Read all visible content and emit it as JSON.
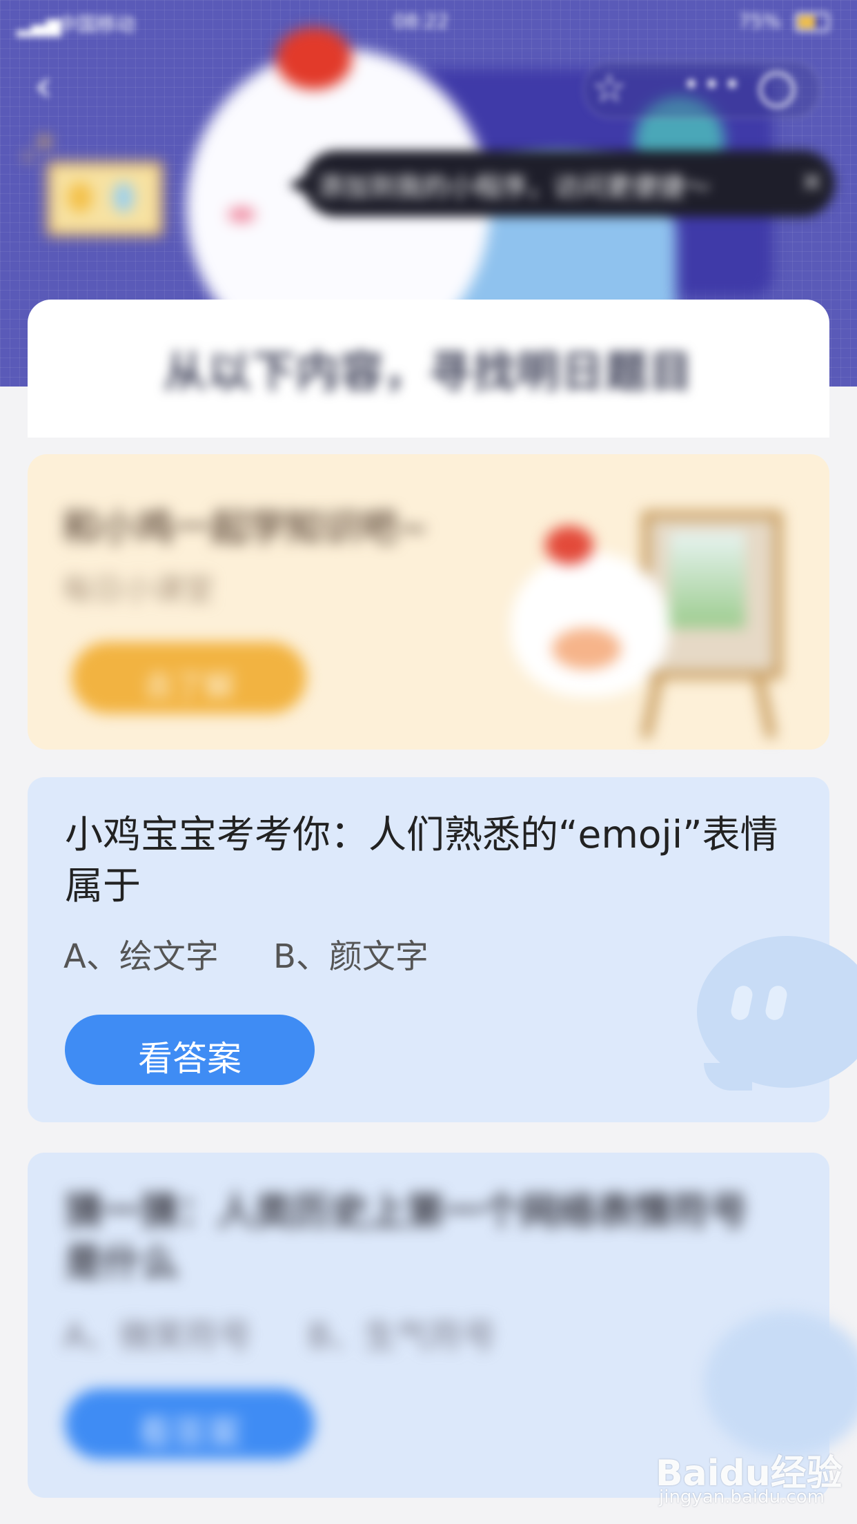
{
  "status_bar": {
    "carrier": "中国移动",
    "time": "08:22",
    "battery": "75%"
  },
  "header": {
    "tip": "添加到我的小程序，访问更便捷～",
    "title": "从以下内容，寻找明日题目"
  },
  "promo": {
    "title": "和小鸡一起学知识吧~",
    "subtitle": "每日小课堂",
    "button_label": "去了解"
  },
  "question": {
    "text": "小鸡宝宝考考你：人们熟悉的“emoji”表情属于",
    "option_a": "A、绘文字",
    "option_b": "B、颜文字",
    "button_label": "看答案"
  },
  "next_question": {
    "text": "猜一猜：人类历史上第一个网络表情符号是什么",
    "option_a": "A、微笑符号",
    "option_b": "B、生气符号",
    "button_label": "看答案"
  },
  "watermark": {
    "logo": "Baidu经验",
    "url": "jingyan.baidu.com"
  },
  "colors": {
    "header_bg": "#5a5ab8",
    "promo_bg": "#fdf0d8",
    "question_bg": "#dde9fb",
    "button_blue": "#3f8cf4",
    "promo_button": "#f2b341"
  }
}
